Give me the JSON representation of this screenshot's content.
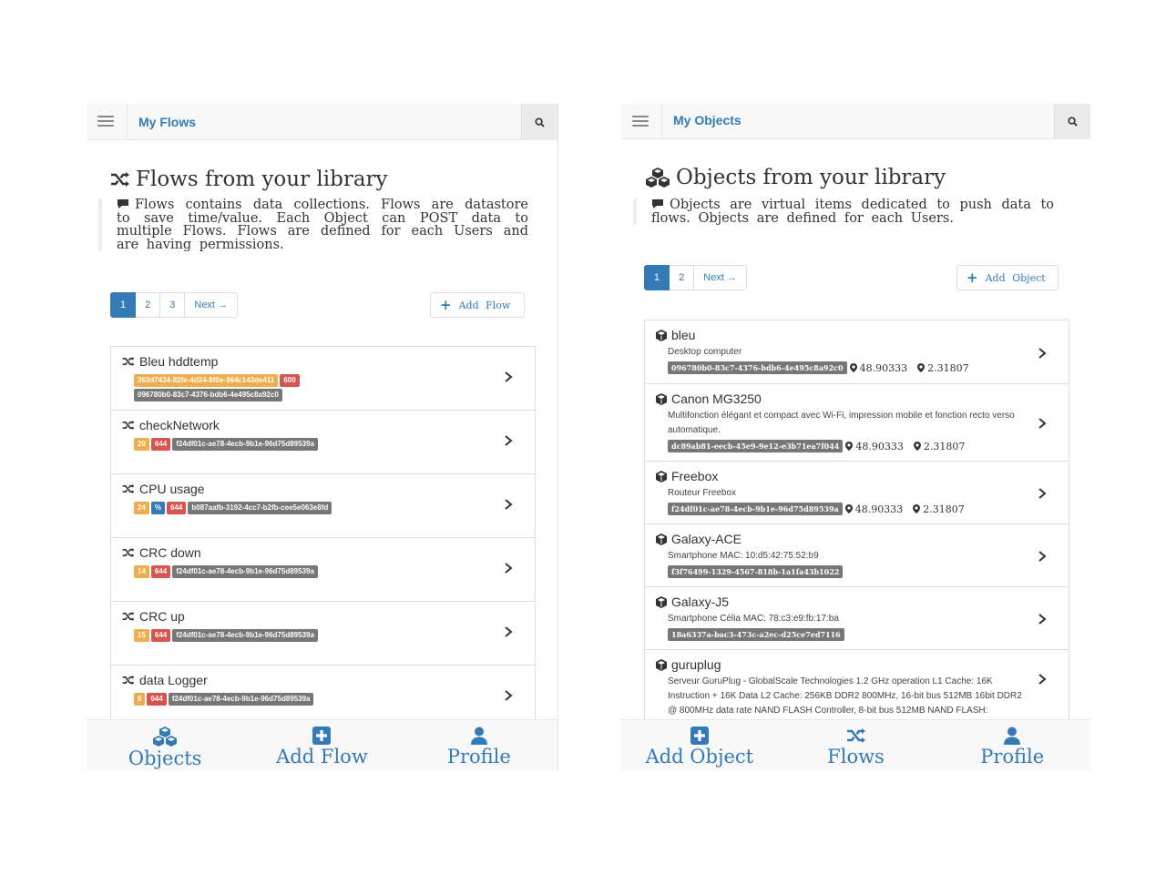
{
  "flows_screen": {
    "nav_title": "My Flows",
    "heading": "Flows from your library",
    "description": "Flows contains data collections. Flows are datastore to save time/value. Each Object can POST data to multiple Flows. Flows are defined for each Users and are having permissions.",
    "pager": [
      "1",
      "2",
      "3",
      "Next →"
    ],
    "add_button_label": "Add Flow",
    "items": [
      {
        "title": "Bleu hddtemp",
        "badges": [
          {
            "text": "363d7434-82fe-4d24-8f0e-964c143de411",
            "color": "orange"
          },
          {
            "text": "600",
            "color": "red"
          },
          {
            "text": "096780b0-83c7-4376-bdb6-4e495c8a92c0",
            "color": "gray"
          }
        ]
      },
      {
        "title": "checkNetwork",
        "badges": [
          {
            "text": "20",
            "color": "orange"
          },
          {
            "text": "644",
            "color": "red"
          },
          {
            "text": "f24df01c-ae78-4ecb-9b1e-96d75d89539a",
            "color": "gray"
          }
        ]
      },
      {
        "title": "CPU usage",
        "badges": [
          {
            "text": "24",
            "color": "orange"
          },
          {
            "text": "%",
            "color": "blue"
          },
          {
            "text": "644",
            "color": "red"
          },
          {
            "text": "b087aafb-3192-4cc7-b2fb-cee5e063e8fd",
            "color": "gray"
          }
        ]
      },
      {
        "title": "CRC down",
        "badges": [
          {
            "text": "14",
            "color": "orange"
          },
          {
            "text": "644",
            "color": "red"
          },
          {
            "text": "f24df01c-ae78-4ecb-9b1e-96d75d89539a",
            "color": "gray"
          }
        ]
      },
      {
        "title": "CRC up",
        "badges": [
          {
            "text": "15",
            "color": "orange"
          },
          {
            "text": "644",
            "color": "red"
          },
          {
            "text": "f24df01c-ae78-4ecb-9b1e-96d75d89539a",
            "color": "gray"
          }
        ]
      },
      {
        "title": "data Logger",
        "badges": [
          {
            "text": "6",
            "color": "orange"
          },
          {
            "text": "644",
            "color": "red"
          },
          {
            "text": "f24df01c-ae78-4ecb-9b1e-96d75d89539a",
            "color": "gray"
          }
        ]
      }
    ],
    "bottom_nav": [
      {
        "label": "Objects",
        "icon": "cubes-icon"
      },
      {
        "label": "Add Flow",
        "icon": "plus-square-icon"
      },
      {
        "label": "Profile",
        "icon": "user-icon"
      }
    ]
  },
  "objects_screen": {
    "nav_title": "My Objects",
    "heading": "Objects from your library",
    "description": "Objects are virtual items dedicated to push data to flows. Objects are defined for each Users.",
    "pager": [
      "1",
      "2",
      "Next →"
    ],
    "add_button_label": "Add Object",
    "items": [
      {
        "title": "bleu",
        "description": "Desktop computer",
        "id": "096780b0-83c7-4376-bdb6-4e495c8a92c0",
        "lat": "48.90333",
        "lon": "2.31807"
      },
      {
        "title": "Canon MG3250",
        "description": "Multifonction élégant et compact avec Wi-Fi, impression mobile et fonction recto verso automatique.",
        "id": "dc89ab81-eecb-45e9-9e12-e3b71ea7f044",
        "lat": "48.90333",
        "lon": "2.31807"
      },
      {
        "title": "Freebox",
        "description": "Routeur Freebox",
        "id": "f24df01c-ae78-4ecb-9b1e-96d75d89539a",
        "lat": "48.90333",
        "lon": "2.31807"
      },
      {
        "title": "Galaxy-ACE",
        "description": "Smartphone MAC: 10:d5:42:75:52:b9",
        "id": "f3f76499-1329-4567-818b-1a1fa43b1022",
        "lat": "",
        "lon": ""
      },
      {
        "title": "Galaxy-J5",
        "description": "Smartphone Célia MAC: 78:c3:e9:fb:17:ba",
        "id": "18a6337a-bac3-473c-a2ec-d25ce7ed7116",
        "lat": "",
        "lon": ""
      },
      {
        "title": "guruplug",
        "description": "Serveur GuruPlug - GlobalScale Technologies 1.2 GHz operation L1 Cache: 16K Instruction + 16K Data L2 Cache: 256KB DDR2 800MHz, 16-bit bus 512MB 16bit DDR2 @ 800MHz data rate NAND FLASH Controller, 8-bit bus 512MB NAND FLASH:",
        "id": "",
        "lat": "",
        "lon": ""
      }
    ],
    "bottom_nav": [
      {
        "label": "Add Object",
        "icon": "plus-square-icon"
      },
      {
        "label": "Flows",
        "icon": "random-icon"
      },
      {
        "label": "Profile",
        "icon": "user-icon"
      }
    ]
  },
  "colors": {
    "primary": "#337ab7",
    "orange": "#f0ad4e",
    "red": "#d9534f",
    "gray": "#777777"
  }
}
